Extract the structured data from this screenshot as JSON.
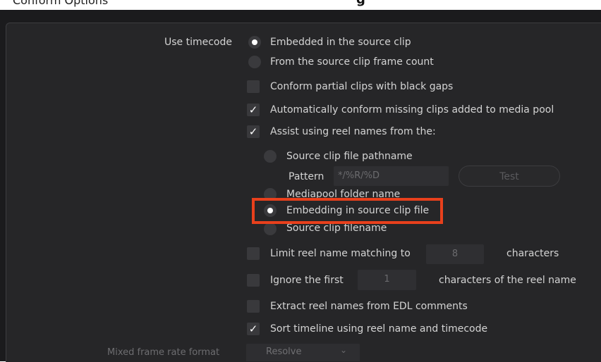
{
  "header": {
    "title": "Conform Options",
    "right_text": "g"
  },
  "use_timecode": {
    "label": "Use timecode",
    "options": [
      {
        "label": "Embedded in the source clip",
        "selected": true
      },
      {
        "label": "From the source clip frame count",
        "selected": false
      }
    ]
  },
  "options": {
    "conform_partial": {
      "label": "Conform partial clips with black gaps",
      "checked": false
    },
    "auto_conform": {
      "label": "Automatically conform missing clips added to media pool",
      "checked": true
    },
    "assist_reel": {
      "label": "Assist using reel names from the:",
      "checked": true
    }
  },
  "reel_source": {
    "options": [
      {
        "label": "Source clip file pathname",
        "selected": false
      },
      {
        "label": "Mediapool folder name",
        "selected": false
      },
      {
        "label": "Embedding in source clip file",
        "selected": true
      },
      {
        "label": "Source clip filename",
        "selected": false
      }
    ],
    "pattern_label": "Pattern",
    "pattern_value": "*/%R/%D",
    "test_label": "Test"
  },
  "limit_reel": {
    "label": "Limit reel name matching to",
    "value": "8",
    "suffix": "characters",
    "checked": false
  },
  "ignore_first": {
    "label": "Ignore the first",
    "value": "1",
    "suffix": "characters of the reel name",
    "checked": false
  },
  "extract_edl": {
    "label": "Extract reel names from EDL comments",
    "checked": false
  },
  "sort_timeline": {
    "label": "Sort timeline using reel name and timecode",
    "checked": true
  },
  "mixed_frame_rate": {
    "label": "Mixed frame rate format",
    "value": "Resolve"
  },
  "colors": {
    "accent_highlight": "#e8401c",
    "panel": "#262628",
    "text": "#d4d4d4"
  }
}
